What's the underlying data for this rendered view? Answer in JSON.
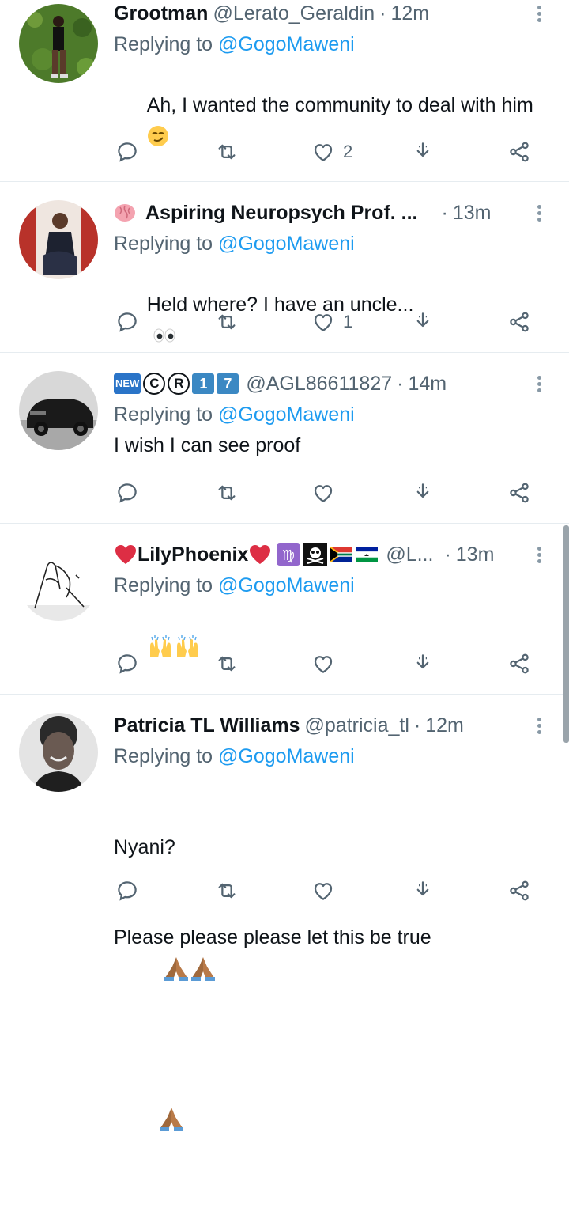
{
  "tweets": [
    {
      "name": "Grootman",
      "handle": "@Lerato_Geraldin",
      "time": "12m",
      "replying_prefix": "Replying to ",
      "replying_to": "@GogoMaweni",
      "text": "Ah, I wanted the community to deal with him",
      "text_emoji": "smirk-emoji",
      "likes": "2",
      "retweets": "",
      "replies": ""
    },
    {
      "name_emoji": "brain-emoji",
      "name": "Aspiring Neuropsych Prof. ...",
      "handle": "",
      "time": "13m",
      "replying_prefix": "Replying to ",
      "replying_to": "@GogoMaweni",
      "text": "Held where? I have an uncle...",
      "text_emoji": "eyes-emoji",
      "likes": "1",
      "retweets": "",
      "replies": ""
    },
    {
      "name_badges": [
        "NEW",
        "C",
        "R",
        "1",
        "7"
      ],
      "handle": "@AGL86611827",
      "time": "14m",
      "replying_prefix": "Replying to ",
      "replying_to": "@GogoMaweni",
      "text": "I wish I can see proof",
      "likes": "",
      "retweets": "",
      "replies": ""
    },
    {
      "name": "LilyPhoenix",
      "name_emojis": [
        "heart-emoji",
        "virgo-emoji",
        "skull-crossbones-emoji",
        "south-africa-flag",
        "lesotho-flag"
      ],
      "handle": "@L...",
      "time": "13m",
      "replying_prefix": "Replying to ",
      "replying_to": "@GogoMaweni",
      "text_emojis": [
        "raised-hands-emoji",
        "raised-hands-emoji"
      ],
      "likes": "",
      "retweets": "",
      "replies": ""
    },
    {
      "name": "Patricia TL Williams",
      "handle": "@patricia_tl",
      "time": "12m",
      "replying_prefix": "Replying to ",
      "replying_to": "@GogoMaweni",
      "text_line1": "Nyani?",
      "text_line2": "Please please please let this be true",
      "text_emojis": [
        "folded-hands-emoji",
        "folded-hands-emoji",
        "folded-hands-emoji"
      ],
      "likes": "",
      "retweets": "",
      "replies": ""
    }
  ],
  "colors": {
    "link": "#1d9bf0",
    "secondary_text": "#536471",
    "primary_text": "#0f1419",
    "divider": "#e6ecf0"
  },
  "icons": [
    "reply-icon",
    "retweet-icon",
    "like-icon",
    "download-icon",
    "share-icon",
    "more-icon"
  ]
}
